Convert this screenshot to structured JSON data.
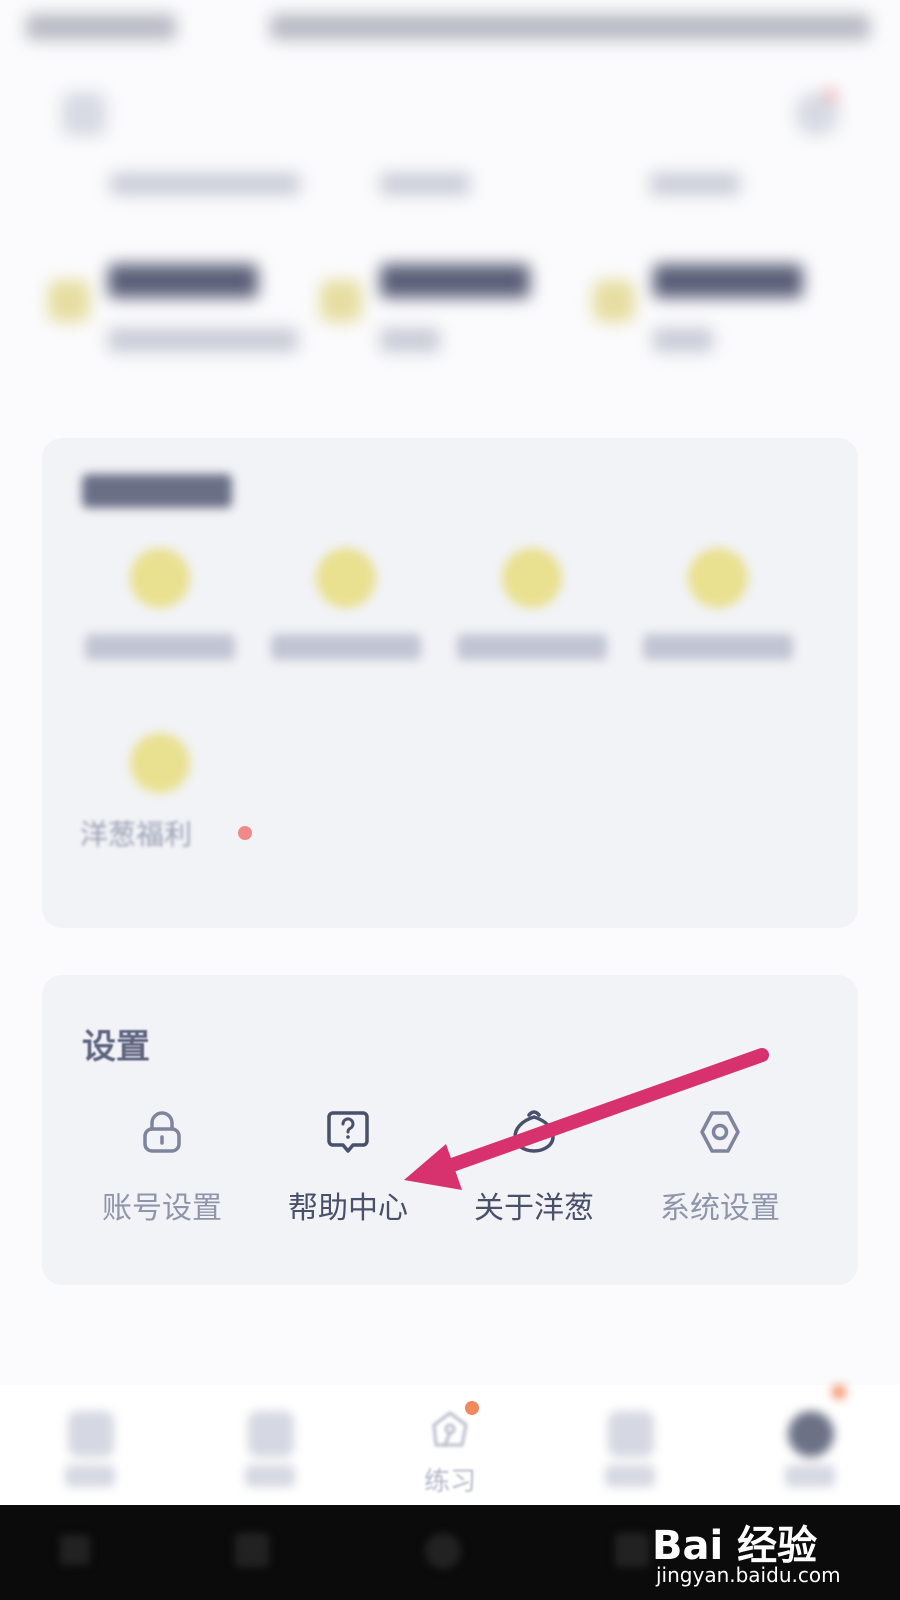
{
  "services": {
    "welfare_label": "洋葱福利"
  },
  "settings": {
    "title": "设置",
    "items": [
      {
        "label": "账号设置",
        "icon": "lock-icon"
      },
      {
        "label": "帮助中心",
        "icon": "help-bubble-icon"
      },
      {
        "label": "关于洋葱",
        "icon": "onion-icon"
      },
      {
        "label": "系统设置",
        "icon": "gear-icon"
      }
    ]
  },
  "bottom_nav": {
    "practice_label": "练习"
  },
  "annotation": {
    "arrow_color": "#d8326e",
    "target": "help-center"
  },
  "watermark": {
    "logo": "Bai 经验",
    "url": "jingyan.baidu.com"
  },
  "colors": {
    "background": "#fbfbfd",
    "card": "#f2f3f7",
    "text": "#4a506a",
    "accent_dot": "#f08a8a"
  }
}
